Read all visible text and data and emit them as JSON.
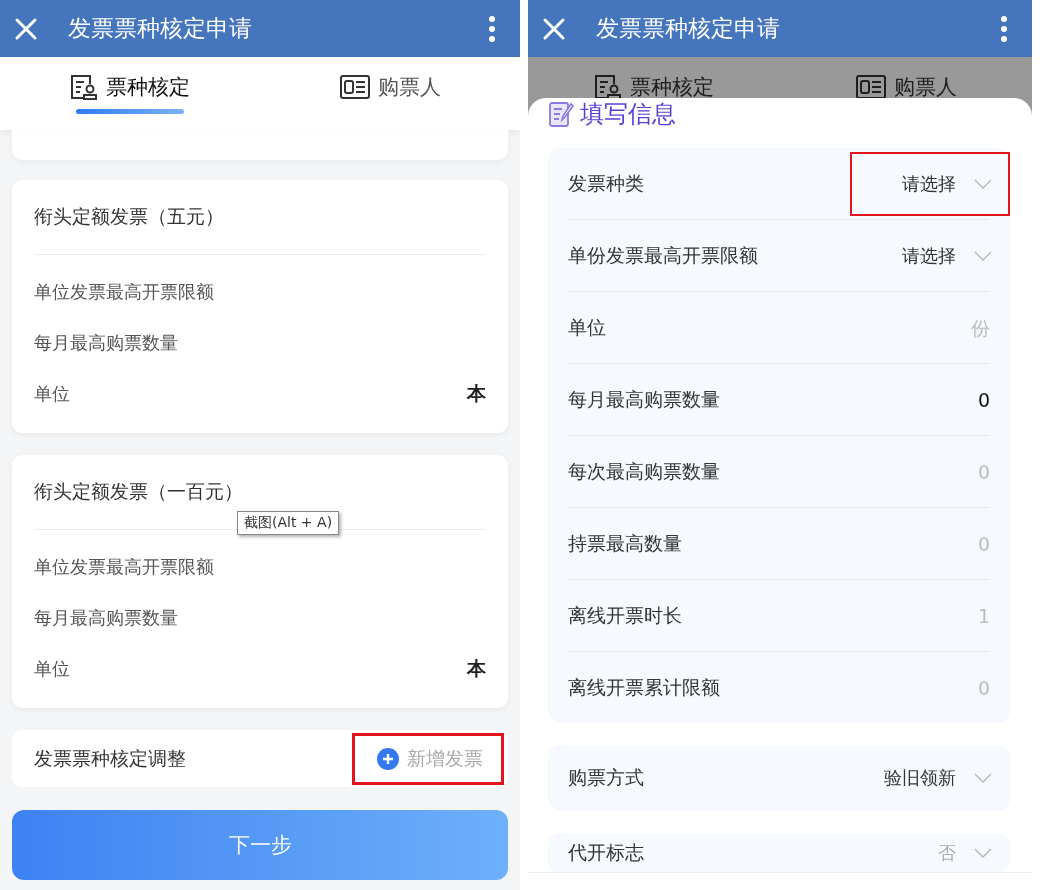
{
  "left_screen": {
    "title": "发票票种核定申请",
    "tabs": [
      {
        "label": "票种核定",
        "selected": true
      },
      {
        "label": "购票人",
        "selected": false
      }
    ],
    "cards": [
      {
        "title": "衔头定额发票（五元）",
        "rows": [
          {
            "label": "单位发票最高开票限额"
          },
          {
            "label": "每月最高购票数量"
          },
          {
            "label": "单位",
            "value": "本"
          }
        ]
      },
      {
        "title": "衔头定额发票（一百元）",
        "rows": [
          {
            "label": "单位发票最高开票限额"
          },
          {
            "label": "每月最高购票数量"
          },
          {
            "label": "单位",
            "value": "本"
          }
        ]
      }
    ],
    "adjust": {
      "label": "发票票种核定调整",
      "button": "新增发票",
      "highlighted": true
    },
    "tooltip": "截图(Alt + A)",
    "next_button": "下一步"
  },
  "right_screen": {
    "title": "发票票种核定申请",
    "tabs": [
      {
        "label": "票种核定"
      },
      {
        "label": "购票人"
      }
    ],
    "sheet_title": "填写信息",
    "groups": [
      [
        {
          "label": "发票种类",
          "kind": "select",
          "value": "请选择",
          "highlighted": true
        },
        {
          "label": "单份发票最高开票限额",
          "kind": "select",
          "value": "请选择",
          "highlighted": false
        },
        {
          "label": "单位",
          "kind": "input",
          "placeholder": "份"
        },
        {
          "label": "每月最高购票数量",
          "kind": "input",
          "value": "0"
        },
        {
          "label": "每次最高购票数量",
          "kind": "input",
          "placeholder": "0"
        },
        {
          "label": "持票最高数量",
          "kind": "input",
          "placeholder": "0"
        },
        {
          "label": "离线开票时长",
          "kind": "input",
          "placeholder": "1"
        },
        {
          "label": "离线开票累计限额",
          "kind": "input",
          "placeholder": "0"
        }
      ],
      [
        {
          "label": "购票方式",
          "kind": "select",
          "value": "验旧领新",
          "highlighted": false
        }
      ],
      [
        {
          "label": "代开标志",
          "kind": "select",
          "placeholder": "否",
          "highlighted": false
        }
      ]
    ]
  }
}
